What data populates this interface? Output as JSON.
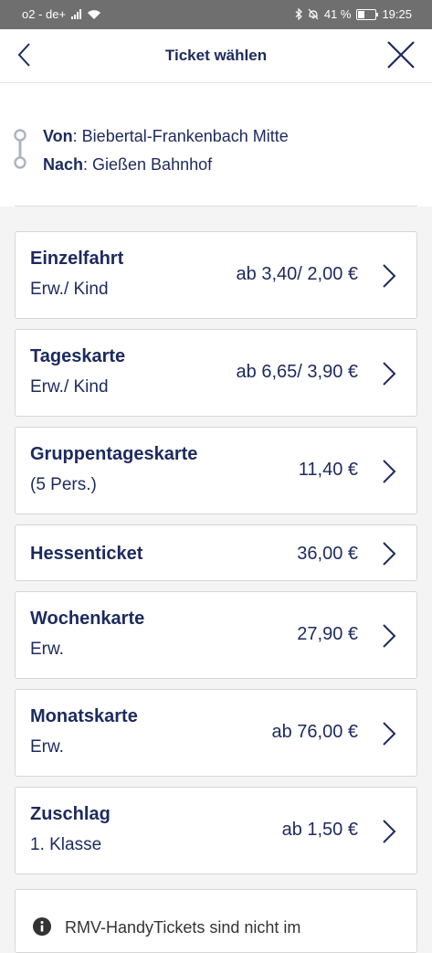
{
  "status_bar": {
    "carrier": "o2 - de+",
    "battery": "41 %",
    "battery_level": 0.41,
    "time": "19:25",
    "icons": [
      "signal-icon",
      "wifi-icon",
      "bluetooth-icon",
      "mute-icon",
      "battery-icon"
    ]
  },
  "header": {
    "title": "Ticket wählen",
    "back_icon": "chevron-left-icon",
    "close_icon": "close-icon"
  },
  "route": {
    "from_label": "Von",
    "from_value": ": Biebertal-Frankenbach Mitte",
    "to_label": "Nach",
    "to_value": ": Gießen Bahnhof"
  },
  "tickets": [
    {
      "name": "Einzelfahrt",
      "sub": "Erw./ Kind",
      "price": "ab 3,40/ 2,00 €"
    },
    {
      "name": "Tageskarte",
      "sub": "Erw./ Kind",
      "price": "ab 6,65/ 3,90 €"
    },
    {
      "name": "Gruppentageskarte",
      "sub": "(5 Pers.)",
      "price": "11,40 €"
    },
    {
      "name": "Hessenticket",
      "sub": "",
      "price": "36,00 €"
    },
    {
      "name": "Wochenkarte",
      "sub": "Erw.",
      "price": "27,90 €"
    },
    {
      "name": "Monatskarte",
      "sub": "Erw.",
      "price": "ab 76,00 €"
    },
    {
      "name": "Zuschlag",
      "sub": "1. Klasse",
      "price": "ab 1,50 €"
    }
  ],
  "info": {
    "icon": "info-icon",
    "text": "RMV-HandyTickets sind nicht im"
  },
  "colors": {
    "primary": "#1c2a5e",
    "status_bar": "#6f6f6f",
    "background": "#f4f4f4"
  }
}
